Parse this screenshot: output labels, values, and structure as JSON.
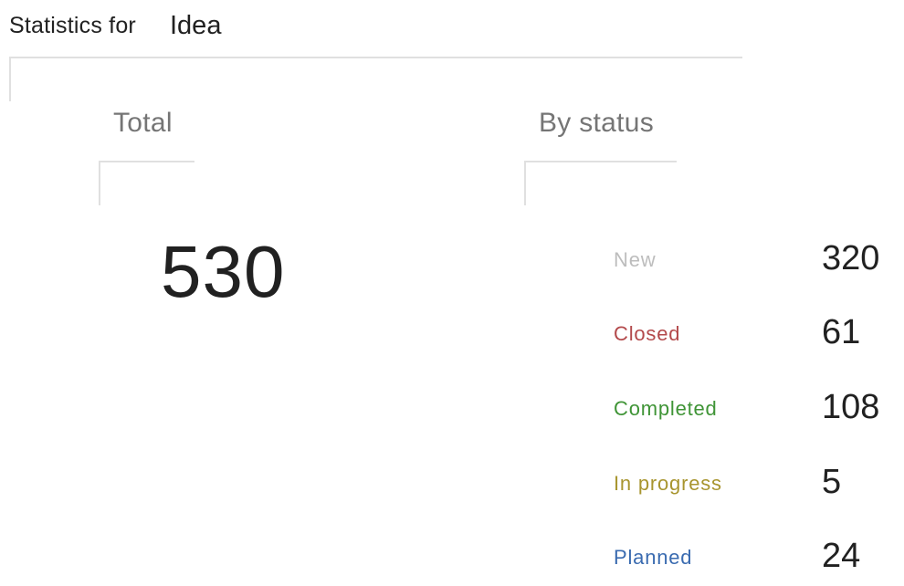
{
  "header": {
    "prefix": "Statistics for",
    "selected_type": "Idea"
  },
  "total": {
    "title": "Total",
    "value": "530"
  },
  "by_status": {
    "title": "By status",
    "items": [
      {
        "label": "New",
        "value": "320",
        "color": "#bdbdbd"
      },
      {
        "label": "Closed",
        "value": "61",
        "color": "#b3494b"
      },
      {
        "label": "Completed",
        "value": "108",
        "color": "#3f9436"
      },
      {
        "label": "In progress",
        "value": "5",
        "color": "#a8952f"
      },
      {
        "label": "Planned",
        "value": "24",
        "color": "#3a6bb0"
      }
    ]
  }
}
